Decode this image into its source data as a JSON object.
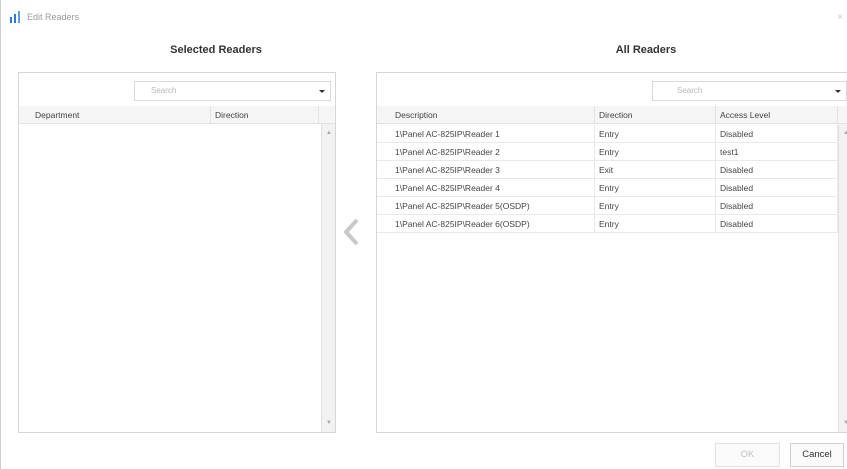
{
  "window": {
    "title": "Edit Readers",
    "close_glyph": "×"
  },
  "selected": {
    "heading": "Selected Readers",
    "search_placeholder": "Search",
    "columns": [
      "Department",
      "Direction"
    ],
    "rows": []
  },
  "all": {
    "heading": "All Readers",
    "search_placeholder": "Search",
    "columns": [
      "Description",
      "Direction",
      "Access Level"
    ],
    "rows": [
      [
        "1\\Panel  AC-825IP\\Reader 1",
        "Entry",
        "Disabled"
      ],
      [
        "1\\Panel  AC-825IP\\Reader 2",
        "Entry",
        "test1"
      ],
      [
        "1\\Panel  AC-825IP\\Reader 3",
        "Exit",
        "Disabled"
      ],
      [
        "1\\Panel  AC-825IP\\Reader 4",
        "Entry",
        "Disabled"
      ],
      [
        "1\\Panel  AC-825IP\\Reader 5(OSDP)",
        "Entry",
        "Disabled"
      ],
      [
        "1\\Panel  AC-825IP\\Reader 6(OSDP)",
        "Entry",
        "Disabled"
      ]
    ]
  },
  "buttons": {
    "ok": "OK",
    "cancel": "Cancel"
  },
  "icons": {
    "title": "edit-readers-icon",
    "move_left": "chevron-left-icon",
    "dropdown": "dropdown-arrow-icon"
  },
  "colors": {
    "accent": "#2b7bd6",
    "disabled_text": "#c2c2c2",
    "chevron": "#c9c9c9"
  }
}
